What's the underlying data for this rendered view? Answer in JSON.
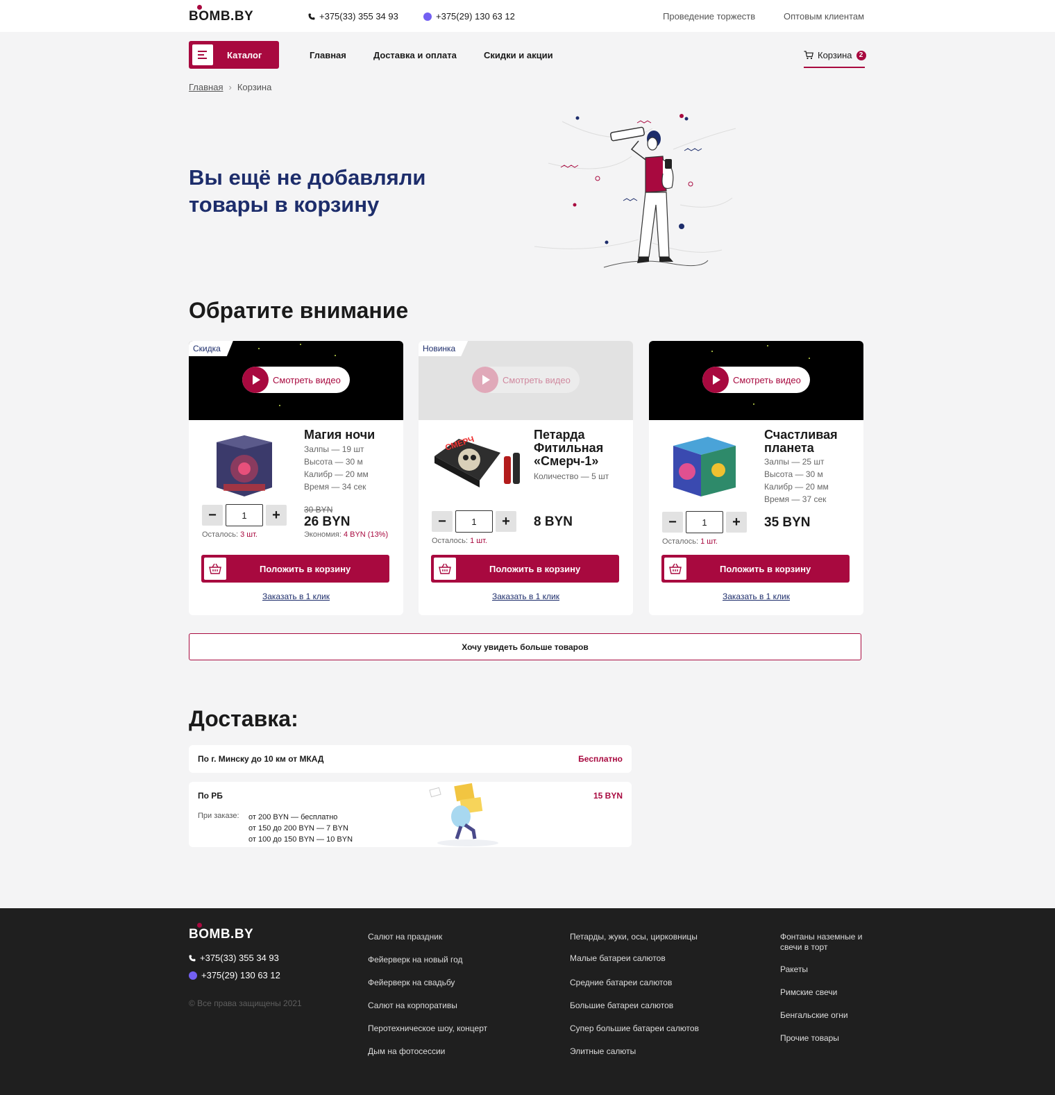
{
  "brand": {
    "logo": "BOMB.BY",
    "accent": "#a8093f",
    "dark_blue": "#1d2d6b"
  },
  "header": {
    "phone_1": "+375(33) 355 34 93",
    "phone_2": "+375(29) 130 63 12",
    "link_events": "Проведение торжеств",
    "link_wholesale": "Оптовым клиентам"
  },
  "nav": {
    "catalog": "Каталог",
    "home": "Главная",
    "delivery": "Доставка и оплата",
    "sales": "Скидки и акции",
    "cart": "Корзина",
    "cart_count": "2"
  },
  "breadcrumb": {
    "home": "Главная",
    "current": "Корзина"
  },
  "empty_cart": {
    "title": "Вы ещё не добавляли товары в корзину"
  },
  "recommend": {
    "title": "Обратите внимание",
    "video_label": "Смотреть видео",
    "add_label": "Положить в корзину",
    "one_click_label": "Заказать в 1 клик",
    "stock_label": "Осталось:",
    "products": [
      {
        "tag": "Скидка",
        "name": "Магия ночи",
        "specs": [
          "Залпы — 19 шт",
          "Высота — 30 м",
          "Калибр — 20 мм",
          "Время — 34 сек"
        ],
        "qty": "1",
        "old_price": "30 BYN",
        "price": "26 BYN",
        "saving_label": "Экономия:",
        "saving_value": "4 BYN (13%)",
        "stock": "3 шт."
      },
      {
        "tag": "Новинка",
        "name": "Петарда Фитильная «Смерч-1»",
        "specs": [
          "Количество — 5 шт"
        ],
        "qty": "1",
        "price": "8 BYN",
        "stock": "1 шт."
      },
      {
        "name": "Счастливая планета",
        "specs": [
          "Залпы — 25 шт",
          "Высота — 30 м",
          "Калибр — 20 мм",
          "Время — 37 сек"
        ],
        "qty": "1",
        "price": "35 BYN",
        "stock": "1 шт."
      }
    ],
    "more_button": "Хочу увидеть больше товаров"
  },
  "delivery": {
    "title": "Доставка:",
    "minsk_label": "По г. Минску до 10 км от МКАД",
    "minsk_price": "Бесплатно",
    "rb_label": "По РБ",
    "rb_price": "15 BYN",
    "rb_note": "При заказе:",
    "rb_tiers": [
      "от 200 BYN — бесплатно",
      "от 150 до 200 BYN — 7 BYN",
      "от 100 до 150 BYN — 10 BYN"
    ]
  },
  "footer": {
    "logo": "BOMB.BY",
    "phone_1": "+375(33) 355 34 93",
    "phone_2": "+375(29) 130 63 12",
    "copyright": "© Все права защищены 2021",
    "col1": [
      "Салют на праздник",
      "Фейерверк на новый год",
      "Фейерверк на свадьбу",
      "Салют на корпоративы",
      "Перотехническое шоу, концерт",
      "Дым на фотосессии"
    ],
    "col2": [
      "Петарды, жуки, осы, цирковницы",
      "Малые батареи салютов",
      "Средние батареи салютов",
      "Большие батареи салютов",
      "Супер большие батареи салютов",
      "Элитные салюты"
    ],
    "col3": [
      "Фонтаны наземные и свечи в торт",
      "Ракеты",
      "Римские свечи",
      "Бенгальские огни",
      "Прочие товары"
    ]
  }
}
